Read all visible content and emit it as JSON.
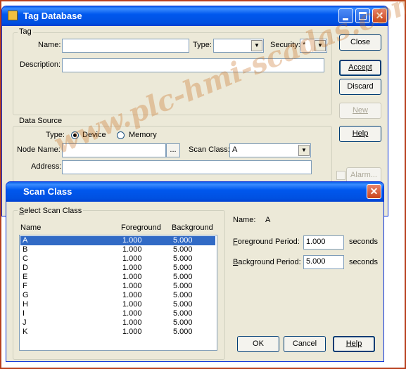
{
  "tag_db": {
    "title": "Tag Database",
    "tag_group": "Tag",
    "name_label": "Name:",
    "name_value": "",
    "type_label": "Type:",
    "type_value": "",
    "security_label": "Security:",
    "security_value": "*",
    "description_label": "Description:",
    "description_value": "",
    "data_source_group": "Data Source",
    "ds_type_label": "Type:",
    "device_label": "Device",
    "memory_label": "Memory",
    "node_name_label": "Node Name:",
    "node_name_value": "",
    "browse_label": "...",
    "scan_class_label": "Scan Class:",
    "scan_class_value": "A",
    "address_label": "Address:",
    "address_value": "",
    "buttons": {
      "close": "Close",
      "accept": "Accept",
      "discard": "Discard",
      "new": "New",
      "help": "Help",
      "alarm": "Alarm..."
    }
  },
  "scan_class": {
    "title": "Scan Class",
    "group": "Select Scan Class",
    "columns": [
      "Name",
      "Foreground",
      "Background"
    ],
    "rows": [
      {
        "name": "A",
        "fg": "1.000",
        "bg": "5.000"
      },
      {
        "name": "B",
        "fg": "1.000",
        "bg": "5.000"
      },
      {
        "name": "C",
        "fg": "1.000",
        "bg": "5.000"
      },
      {
        "name": "D",
        "fg": "1.000",
        "bg": "5.000"
      },
      {
        "name": "E",
        "fg": "1.000",
        "bg": "5.000"
      },
      {
        "name": "F",
        "fg": "1.000",
        "bg": "5.000"
      },
      {
        "name": "G",
        "fg": "1.000",
        "bg": "5.000"
      },
      {
        "name": "H",
        "fg": "1.000",
        "bg": "5.000"
      },
      {
        "name": "I",
        "fg": "1.000",
        "bg": "5.000"
      },
      {
        "name": "J",
        "fg": "1.000",
        "bg": "5.000"
      },
      {
        "name": "K",
        "fg": "1.000",
        "bg": "5.000"
      }
    ],
    "name_label": "Name:",
    "name_value": "A",
    "fg_label": "Foreground Period:",
    "fg_value": "1.000",
    "bg_label": "Background Period:",
    "bg_value": "5.000",
    "seconds": "seconds",
    "ok": "OK",
    "cancel": "Cancel",
    "help": "Help"
  },
  "watermark": "www.plc-hmi-scadas.com",
  "colors": {
    "title_blue": "#0058ee",
    "selection": "#316ac5",
    "face": "#ece9d8",
    "frame": "#b8401f"
  }
}
